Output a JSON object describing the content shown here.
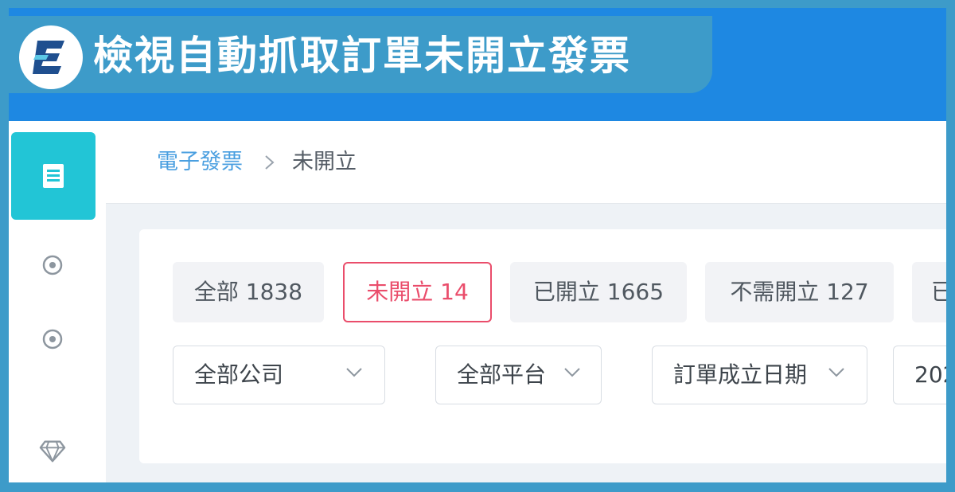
{
  "banner": {
    "title": "檢視自動抓取訂單未開立發票",
    "logo": "E-logo-icon"
  },
  "colors": {
    "frame": "#3d9bc9",
    "topbar": "#1e88e2",
    "sidebar_active": "#22c5d6",
    "active_tab": "#ea4d6b",
    "link": "#4a9fe0"
  },
  "sidebar": {
    "items": [
      {
        "icon": "receipt-icon",
        "active": true
      },
      {
        "icon": "dot-circle-icon",
        "active": false
      },
      {
        "icon": "dot-circle-icon",
        "active": false
      },
      {
        "icon": "diamond-icon",
        "active": false
      }
    ]
  },
  "breadcrumb": {
    "parent": "電子發票",
    "separator": ">",
    "current": "未開立"
  },
  "tabs": [
    {
      "label": "全部 1838",
      "active": false
    },
    {
      "label": "未開立 14",
      "active": true
    },
    {
      "label": "已開立 1665",
      "active": false
    },
    {
      "label": "不需開立 127",
      "active": false
    },
    {
      "label": "已",
      "active": false
    }
  ],
  "filters": {
    "company": "全部公司",
    "platform": "全部平台",
    "date_type": "訂單成立日期",
    "date_value": "202"
  }
}
